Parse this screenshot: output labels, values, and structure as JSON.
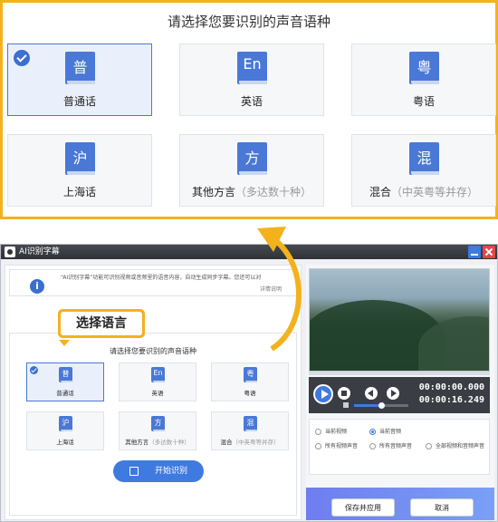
{
  "zoom": {
    "title": "请选择您要识别的声音语种",
    "languages": [
      {
        "glyph": "普",
        "label": "普通话",
        "sub": "",
        "selected": true
      },
      {
        "glyph": "En",
        "label": "英语",
        "sub": "",
        "selected": false
      },
      {
        "glyph": "粤",
        "label": "粤语",
        "sub": "",
        "selected": false
      },
      {
        "glyph": "沪",
        "label": "上海话",
        "sub": "",
        "selected": false
      },
      {
        "glyph": "方",
        "label": "其他方言",
        "sub": "（多达数十种）",
        "selected": false
      },
      {
        "glyph": "混",
        "label": "混合",
        "sub": "（中英粤等并存）",
        "selected": false
      }
    ]
  },
  "window": {
    "title": "AI识别字幕",
    "info_text": "“AI识别字幕”功能可识别视频或音频里的语音内容，自动生成同步字幕。您还可以对",
    "info_link": "详情说明",
    "callout": "选择语言",
    "section_title": "请选择您要识别的声音语种",
    "start_button": "开始识别",
    "player": {
      "current_time": "00:00:00.000",
      "total_time": "00:00:16.249",
      "volume": 0.5
    },
    "options": [
      {
        "label": "当前视频",
        "selected": false
      },
      {
        "label": "当前音频",
        "selected": true
      },
      {
        "label": "所有视频声音",
        "selected": false
      },
      {
        "label": "所有音频声音",
        "selected": false
      },
      {
        "label": "全部视频和音频声音",
        "selected": false
      }
    ],
    "apply_button": "保存并应用",
    "cancel_button": "取消"
  },
  "colors": {
    "accent": "#3f7ae0",
    "highlight": "#f3b21c"
  },
  "icons": [
    "check-icon",
    "book-icon",
    "info-icon",
    "play-icon",
    "stop-icon",
    "prev-icon",
    "next-icon",
    "volume-icon",
    "scan-icon",
    "arrow-icon"
  ]
}
